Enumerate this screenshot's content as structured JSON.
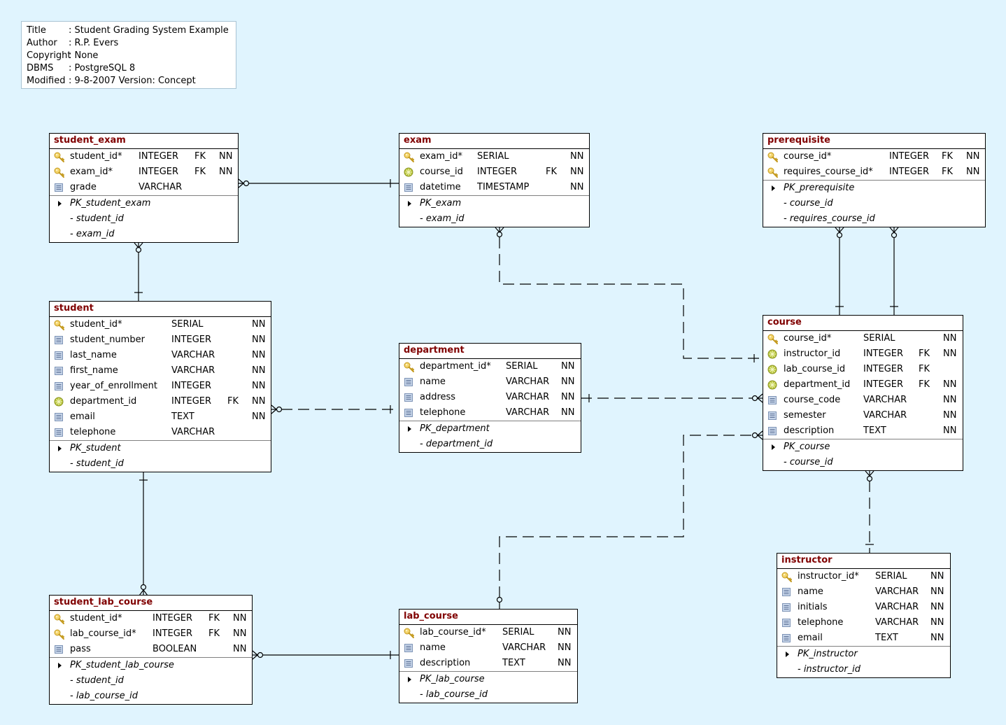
{
  "info": {
    "rows": [
      {
        "key": "Title",
        "value": ": Student Grading System Example"
      },
      {
        "key": "Author",
        "value": ": R.P. Evers"
      },
      {
        "key": "Copyright",
        "value": ": None"
      },
      {
        "key": "DBMS",
        "value": ": PostgreSQL 8"
      },
      {
        "key": "Modified",
        "value": ": 9-8-2007 Version: Concept"
      }
    ]
  },
  "legend_icons": {
    "pk": "key-icon",
    "fk": "foreign-key-icon",
    "col": "column-icon",
    "idx": "index-expand-icon"
  },
  "colors": {
    "background": "#e0f4fe",
    "entity_title": "#800000",
    "border": "#000000"
  },
  "entities": [
    {
      "id": "student_exam",
      "name": "student_exam",
      "columns": [
        {
          "icon": "pk",
          "name": "student_id*",
          "type": "INTEGER",
          "fk": "FK",
          "nn": "NN"
        },
        {
          "icon": "pk",
          "name": "exam_id*",
          "type": "INTEGER",
          "fk": "FK",
          "nn": "NN"
        },
        {
          "icon": "col",
          "name": "grade",
          "type": "VARCHAR",
          "fk": "",
          "nn": ""
        }
      ],
      "index": {
        "name": "PK_student_exam",
        "columns": [
          "- student_id",
          "- exam_id"
        ]
      }
    },
    {
      "id": "exam",
      "name": "exam",
      "columns": [
        {
          "icon": "pk",
          "name": "exam_id*",
          "type": "SERIAL",
          "fk": "",
          "nn": "NN"
        },
        {
          "icon": "fk",
          "name": "course_id",
          "type": "INTEGER",
          "fk": "FK",
          "nn": "NN"
        },
        {
          "icon": "col",
          "name": "datetime",
          "type": "TIMESTAMP",
          "fk": "",
          "nn": "NN"
        }
      ],
      "index": {
        "name": "PK_exam",
        "columns": [
          "- exam_id"
        ]
      }
    },
    {
      "id": "prerequisite",
      "name": "prerequisite",
      "columns": [
        {
          "icon": "pk",
          "name": "course_id*",
          "type": "INTEGER",
          "fk": "FK",
          "nn": "NN"
        },
        {
          "icon": "pk",
          "name": "requires_course_id*",
          "type": "INTEGER",
          "fk": "FK",
          "nn": "NN"
        }
      ],
      "index": {
        "name": "PK_prerequisite",
        "columns": [
          "- course_id",
          "- requires_course_id"
        ]
      }
    },
    {
      "id": "student",
      "name": "student",
      "columns": [
        {
          "icon": "pk",
          "name": "student_id*",
          "type": "SERIAL",
          "fk": "",
          "nn": "NN"
        },
        {
          "icon": "col",
          "name": "student_number",
          "type": "INTEGER",
          "fk": "",
          "nn": "NN"
        },
        {
          "icon": "col",
          "name": "last_name",
          "type": "VARCHAR",
          "fk": "",
          "nn": "NN"
        },
        {
          "icon": "col",
          "name": "first_name",
          "type": "VARCHAR",
          "fk": "",
          "nn": "NN"
        },
        {
          "icon": "col",
          "name": "year_of_enrollment",
          "type": "INTEGER",
          "fk": "",
          "nn": "NN"
        },
        {
          "icon": "fk",
          "name": "department_id",
          "type": "INTEGER",
          "fk": "FK",
          "nn": "NN"
        },
        {
          "icon": "col",
          "name": "email",
          "type": "TEXT",
          "fk": "",
          "nn": "NN"
        },
        {
          "icon": "col",
          "name": "telephone",
          "type": "VARCHAR",
          "fk": "",
          "nn": ""
        }
      ],
      "index": {
        "name": "PK_student",
        "columns": [
          "- student_id"
        ]
      }
    },
    {
      "id": "department",
      "name": "department",
      "columns": [
        {
          "icon": "pk",
          "name": "department_id*",
          "type": "SERIAL",
          "fk": "",
          "nn": "NN"
        },
        {
          "icon": "col",
          "name": "name",
          "type": "VARCHAR",
          "fk": "",
          "nn": "NN"
        },
        {
          "icon": "col",
          "name": "address",
          "type": "VARCHAR",
          "fk": "",
          "nn": "NN"
        },
        {
          "icon": "col",
          "name": "telephone",
          "type": "VARCHAR",
          "fk": "",
          "nn": "NN"
        }
      ],
      "index": {
        "name": "PK_department",
        "columns": [
          "- department_id"
        ]
      }
    },
    {
      "id": "course",
      "name": "course",
      "columns": [
        {
          "icon": "pk",
          "name": "course_id*",
          "type": "SERIAL",
          "fk": "",
          "nn": "NN"
        },
        {
          "icon": "fk",
          "name": "instructor_id",
          "type": "INTEGER",
          "fk": "FK",
          "nn": "NN"
        },
        {
          "icon": "fk",
          "name": "lab_course_id",
          "type": "INTEGER",
          "fk": "FK",
          "nn": ""
        },
        {
          "icon": "fk",
          "name": "department_id",
          "type": "INTEGER",
          "fk": "FK",
          "nn": "NN"
        },
        {
          "icon": "col",
          "name": "course_code",
          "type": "VARCHAR",
          "fk": "",
          "nn": "NN"
        },
        {
          "icon": "col",
          "name": "semester",
          "type": "VARCHAR",
          "fk": "",
          "nn": "NN"
        },
        {
          "icon": "col",
          "name": "description",
          "type": "TEXT",
          "fk": "",
          "nn": "NN"
        }
      ],
      "index": {
        "name": "PK_course",
        "columns": [
          "- course_id"
        ]
      }
    },
    {
      "id": "instructor",
      "name": "instructor",
      "columns": [
        {
          "icon": "pk",
          "name": "instructor_id*",
          "type": "SERIAL",
          "fk": "",
          "nn": "NN"
        },
        {
          "icon": "col",
          "name": "name",
          "type": "VARCHAR",
          "fk": "",
          "nn": "NN"
        },
        {
          "icon": "col",
          "name": "initials",
          "type": "VARCHAR",
          "fk": "",
          "nn": "NN"
        },
        {
          "icon": "col",
          "name": "telephone",
          "type": "VARCHAR",
          "fk": "",
          "nn": "NN"
        },
        {
          "icon": "col",
          "name": "email",
          "type": "TEXT",
          "fk": "",
          "nn": "NN"
        }
      ],
      "index": {
        "name": "PK_instructor",
        "columns": [
          "- instructor_id"
        ]
      }
    },
    {
      "id": "student_lab_course",
      "name": "student_lab_course",
      "columns": [
        {
          "icon": "pk",
          "name": "student_id*",
          "type": "INTEGER",
          "fk": "FK",
          "nn": "NN"
        },
        {
          "icon": "pk",
          "name": "lab_course_id*",
          "type": "INTEGER",
          "fk": "FK",
          "nn": "NN"
        },
        {
          "icon": "col",
          "name": "pass",
          "type": "BOOLEAN",
          "fk": "",
          "nn": "NN"
        }
      ],
      "index": {
        "name": "PK_student_lab_course",
        "columns": [
          "- student_id",
          "- lab_course_id"
        ]
      }
    },
    {
      "id": "lab_course",
      "name": "lab_course",
      "columns": [
        {
          "icon": "pk",
          "name": "lab_course_id*",
          "type": "SERIAL",
          "fk": "",
          "nn": "NN"
        },
        {
          "icon": "col",
          "name": "name",
          "type": "VARCHAR",
          "fk": "",
          "nn": "NN"
        },
        {
          "icon": "col",
          "name": "description",
          "type": "TEXT",
          "fk": "",
          "nn": "NN"
        }
      ],
      "index": {
        "name": "PK_lab_course",
        "columns": [
          "- lab_course_id"
        ]
      }
    }
  ],
  "relationships": [
    {
      "id": "student_exam-exam",
      "from": "exam",
      "to": "student_exam",
      "style": "solid",
      "from_end": "one",
      "to_end": "zero-or-many"
    },
    {
      "id": "student-student_exam",
      "from": "student",
      "to": "student_exam",
      "style": "solid",
      "from_end": "one",
      "to_end": "zero-or-many"
    },
    {
      "id": "course-exam",
      "from": "course",
      "to": "exam",
      "style": "dashed",
      "from_end": "one",
      "to_end": "zero-or-many"
    },
    {
      "id": "course-prerequisite-1",
      "from": "course",
      "to": "prerequisite",
      "style": "solid",
      "from_end": "one",
      "to_end": "zero-or-many"
    },
    {
      "id": "course-prerequisite-2",
      "from": "course",
      "to": "prerequisite",
      "style": "solid",
      "from_end": "one",
      "to_end": "zero-or-many"
    },
    {
      "id": "department-student",
      "from": "department",
      "to": "student",
      "style": "dashed",
      "from_end": "one",
      "to_end": "zero-or-many"
    },
    {
      "id": "department-course",
      "from": "department",
      "to": "course",
      "style": "dashed",
      "from_end": "one",
      "to_end": "zero-or-many"
    },
    {
      "id": "lab_course-course",
      "from": "lab_course",
      "to": "course",
      "style": "dashed",
      "from_end": "zero-or-one",
      "to_end": "zero-or-many"
    },
    {
      "id": "instructor-course",
      "from": "instructor",
      "to": "course",
      "style": "dashed",
      "from_end": "one",
      "to_end": "zero-or-many"
    },
    {
      "id": "student-student_lab_course",
      "from": "student",
      "to": "student_lab_course",
      "style": "solid",
      "from_end": "one",
      "to_end": "zero-or-many"
    },
    {
      "id": "lab_course-student_lab_course",
      "from": "lab_course",
      "to": "student_lab_course",
      "style": "solid",
      "from_end": "one",
      "to_end": "zero-or-many"
    }
  ]
}
